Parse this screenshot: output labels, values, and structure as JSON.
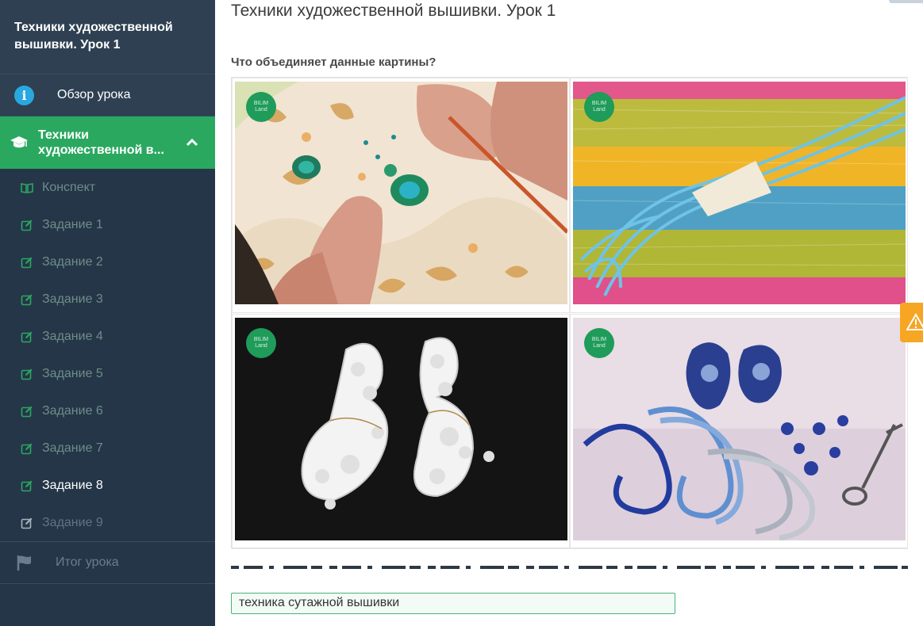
{
  "sidebar": {
    "title": "Техники художественной вышивки. Урок 1",
    "overview_label": "Обзор урока",
    "active_section": {
      "line1": "Техники",
      "line2": "художественной в..."
    },
    "items": [
      {
        "label": "Конспект",
        "icon": "book-icon",
        "state": "done"
      },
      {
        "label": "Задание 1",
        "icon": "edit-icon",
        "state": "done"
      },
      {
        "label": "Задание 2",
        "icon": "edit-icon",
        "state": "done"
      },
      {
        "label": "Задание 3",
        "icon": "edit-icon",
        "state": "done"
      },
      {
        "label": "Задание 4",
        "icon": "edit-icon",
        "state": "done"
      },
      {
        "label": "Задание 5",
        "icon": "edit-icon",
        "state": "done"
      },
      {
        "label": "Задание 6",
        "icon": "edit-icon",
        "state": "done"
      },
      {
        "label": "Задание 7",
        "icon": "edit-icon",
        "state": "done"
      },
      {
        "label": "Задание 8",
        "icon": "edit-icon",
        "state": "current"
      },
      {
        "label": "Задание 9",
        "icon": "edit-icon",
        "state": "pending"
      }
    ],
    "summary_label": "Итог урока"
  },
  "main": {
    "title": "Техники художественной вышивки. Урок 1",
    "question": "Что объединяет данные картины?",
    "images": [
      {
        "logo_line1": "BILIM",
        "logo_line2": "Land",
        "subject": "embroidery-hands"
      },
      {
        "logo_line1": "BILIM",
        "logo_line2": "Land",
        "subject": "colored-threads"
      },
      {
        "logo_line1": "BILIM",
        "logo_line2": "Land",
        "subject": "white-earrings"
      },
      {
        "logo_line1": "BILIM",
        "logo_line2": "Land",
        "subject": "blue-cords-earrings"
      }
    ],
    "answer_value": "техника сутажной вышивки"
  },
  "colors": {
    "sidebar_bg": "#253649",
    "active_green": "#2aa85f",
    "done_text": "#6e8d86",
    "warning": "#f6a623",
    "info_blue": "#29a8e0"
  }
}
